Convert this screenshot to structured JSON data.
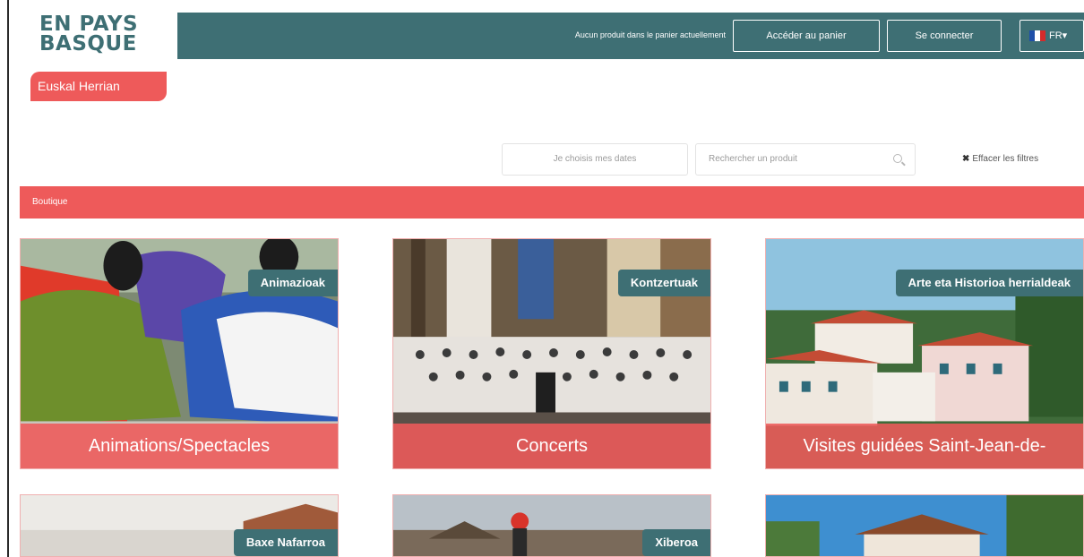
{
  "header": {
    "logo_text": "EN PAYS BASQUE",
    "logo_subtitle": "Euskal Herrian",
    "cart_message": "Aucun produit dans le panier actuellement",
    "cart_button": "Accéder au panier",
    "login_button": "Se connecter",
    "language": "FR",
    "language_caret": "▾"
  },
  "filters": {
    "dates_placeholder": "Je choisis mes dates",
    "search_placeholder": "Rechercher un produit",
    "clear_label": "Effacer les filtres",
    "clear_icon": "✖"
  },
  "breadcrumb": {
    "label": "Boutique"
  },
  "cards": [
    {
      "tag": "Animazioak",
      "title": "Animations/Spectacles"
    },
    {
      "tag": "Kontzertuak",
      "title": "Concerts"
    },
    {
      "tag": "Arte eta Historioa herrialdeak",
      "title": "Visites guidées Saint-Jean-de-"
    },
    {
      "tag": "Baxe Nafarroa",
      "title": ""
    },
    {
      "tag": "Xiberoa",
      "title": ""
    },
    {
      "tag": "",
      "title": ""
    }
  ],
  "colors": {
    "header_teal": "#3e6f74",
    "accent_red": "#ee5a5a"
  },
  "icons": {
    "flag": "flag-fr-icon",
    "search": "search-icon",
    "clear": "close-icon"
  }
}
